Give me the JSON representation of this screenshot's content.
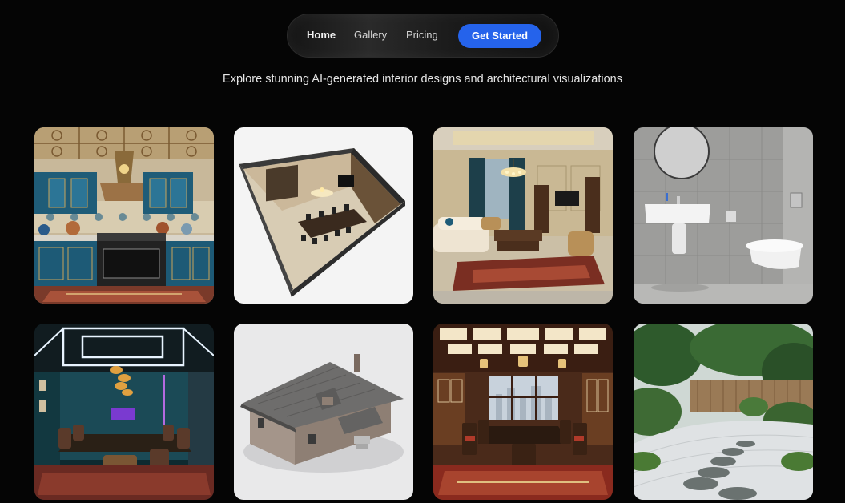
{
  "nav": {
    "home": "Home",
    "gallery": "Gallery",
    "pricing": "Pricing",
    "cta": "Get Started",
    "accent": "#2563eb"
  },
  "tagline": "Explore stunning AI-generated interior designs and architectural visualizations",
  "gallery": {
    "items": [
      {
        "subject": "ornate moroccan blue kitchen"
      },
      {
        "subject": "3d cutaway floor plan dining room"
      },
      {
        "subject": "classic living room with curtains and chandelier"
      },
      {
        "subject": "minimal grey bathroom"
      },
      {
        "subject": "conference room with neon ceiling lights"
      },
      {
        "subject": "3d house model"
      },
      {
        "subject": "asian style dining room"
      },
      {
        "subject": "japanese zen garden with stepping stones"
      }
    ]
  }
}
